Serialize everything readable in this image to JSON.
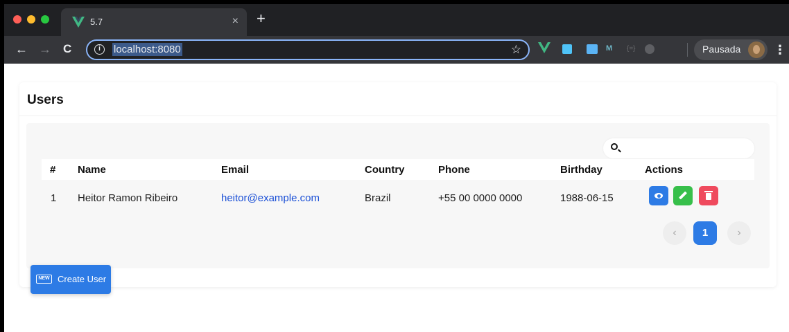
{
  "browser": {
    "tab_title": "5.7",
    "tab_close": "×",
    "new_tab": "+",
    "nav_back": "←",
    "nav_forward": "→",
    "nav_reload": "C",
    "info_icon": "i",
    "url": "localhost:8080",
    "bookmark_star": "☆",
    "profile_name": "Pausada",
    "menu": "⋮",
    "extensions": [
      "vue-devtools-icon",
      "extension-icon",
      "extension-icon",
      "extension-icon",
      "extension-icon",
      "extension-icon"
    ]
  },
  "page": {
    "title": "Users",
    "search": {
      "placeholder": "",
      "value": ""
    },
    "table": {
      "headers": [
        "#",
        "Name",
        "Email",
        "Country",
        "Phone",
        "Birthday",
        "Actions"
      ],
      "rows": [
        {
          "id": "1",
          "name": "Heitor Ramon Ribeiro",
          "email": "heitor@example.com",
          "country": "Brazil",
          "phone": "+55 00 0000 0000",
          "birthday": "1988-06-15"
        }
      ]
    },
    "pagination": {
      "prev": "‹",
      "current": "1",
      "next": "›"
    },
    "create_button": {
      "badge": "NEW",
      "label": "Create User"
    }
  },
  "colors": {
    "primary": "#2d7be5",
    "success": "#37bf4a",
    "danger": "#ef4a5d",
    "link": "#1a4fd6"
  }
}
